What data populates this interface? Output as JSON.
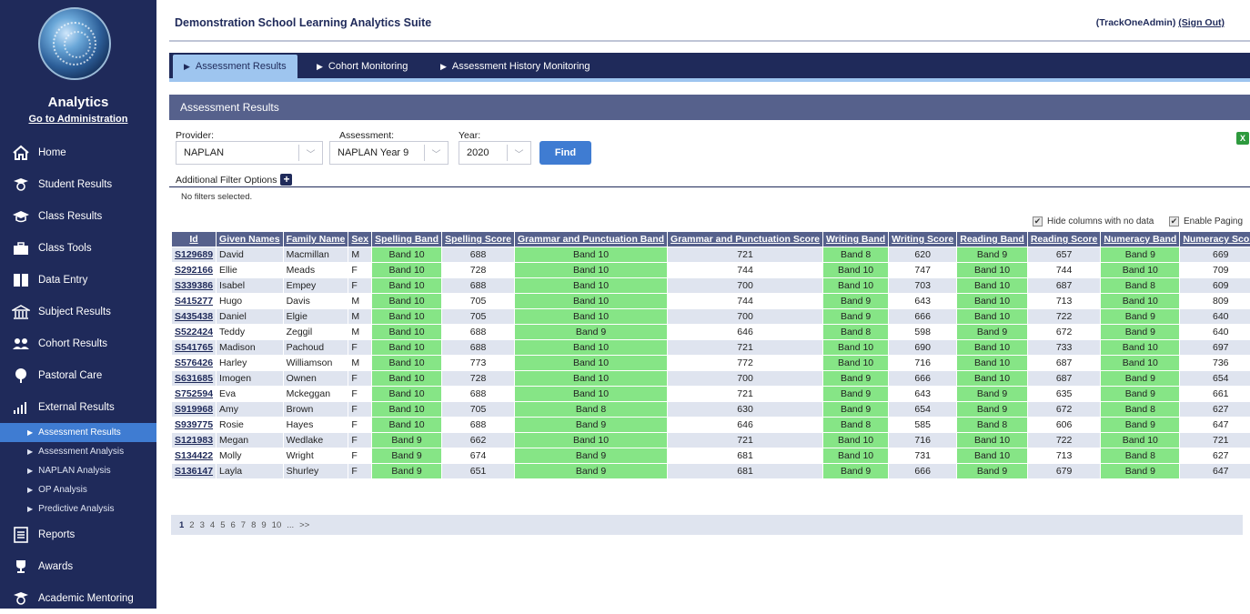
{
  "header": {
    "title": "Demonstration School Learning Analytics Suite",
    "user": "(TrackOneAdmin)",
    "signout": "(Sign Out)"
  },
  "sidebar": {
    "title": "Analytics",
    "admin_link": "Go to Administration",
    "items": [
      {
        "label": "Home",
        "icon": "home-icon"
      },
      {
        "label": "Student Results",
        "icon": "student-icon"
      },
      {
        "label": "Class Results",
        "icon": "class-icon"
      },
      {
        "label": "Class Tools",
        "icon": "toolbox-icon"
      },
      {
        "label": "Data Entry",
        "icon": "book-icon"
      },
      {
        "label": "Subject Results",
        "icon": "building-icon"
      },
      {
        "label": "Cohort Results",
        "icon": "group-icon"
      },
      {
        "label": "Pastoral Care",
        "icon": "tree-icon"
      },
      {
        "label": "External Results",
        "icon": "chart-icon"
      }
    ],
    "subitems": [
      "Assessment Results",
      "Assessment Analysis",
      "NAPLAN Analysis",
      "OP Analysis",
      "Predictive Analysis"
    ],
    "bottom_items": [
      {
        "label": "Reports",
        "icon": "report-icon"
      },
      {
        "label": "Awards",
        "icon": "trophy-icon"
      },
      {
        "label": "Academic Mentoring",
        "icon": "mentor-icon"
      }
    ]
  },
  "tabs": [
    "Assessment Results",
    "Cohort Monitoring",
    "Assessment History Monitoring"
  ],
  "panel": {
    "title": "Assessment Results"
  },
  "filters": {
    "provider_label": "Provider:",
    "provider_value": "NAPLAN",
    "assessment_label": "Assessment:",
    "assessment_value": "NAPLAN Year 9",
    "year_label": "Year:",
    "year_value": "2020",
    "find": "Find",
    "additional": "Additional Filter Options",
    "none": "No filters selected."
  },
  "options": {
    "hide_columns": "Hide columns with no data",
    "enable_paging": "Enable Paging"
  },
  "table": {
    "headers": [
      "Id",
      "Given Names",
      "Family Name",
      "Sex",
      "Spelling Band",
      "Spelling Score",
      "Grammar and Punctuation Band",
      "Grammar and Punctuation Score",
      "Writing Band",
      "Writing Score",
      "Reading Band",
      "Reading Score",
      "Numeracy Band",
      "Numeracy Score"
    ],
    "rows": [
      [
        "S129689",
        "David",
        "Macmillan",
        "M",
        "Band 10",
        "688",
        "Band 10",
        "721",
        "Band 8",
        "620",
        "Band 9",
        "657",
        "Band 9",
        "669"
      ],
      [
        "S292166",
        "Ellie",
        "Meads",
        "F",
        "Band 10",
        "728",
        "Band 10",
        "744",
        "Band 10",
        "747",
        "Band 10",
        "744",
        "Band 10",
        "709"
      ],
      [
        "S339386",
        "Isabel",
        "Empey",
        "F",
        "Band 10",
        "688",
        "Band 10",
        "700",
        "Band 10",
        "703",
        "Band 10",
        "687",
        "Band 8",
        "609"
      ],
      [
        "S415277",
        "Hugo",
        "Davis",
        "M",
        "Band 10",
        "705",
        "Band 10",
        "744",
        "Band 9",
        "643",
        "Band 10",
        "713",
        "Band 10",
        "809"
      ],
      [
        "S435438",
        "Daniel",
        "Elgie",
        "M",
        "Band 10",
        "705",
        "Band 10",
        "700",
        "Band 9",
        "666",
        "Band 10",
        "722",
        "Band 9",
        "640"
      ],
      [
        "S522424",
        "Teddy",
        "Zeggil",
        "M",
        "Band 10",
        "688",
        "Band 9",
        "646",
        "Band 8",
        "598",
        "Band 9",
        "672",
        "Band 9",
        "640"
      ],
      [
        "S541765",
        "Madison",
        "Pachoud",
        "F",
        "Band 10",
        "688",
        "Band 10",
        "721",
        "Band 10",
        "690",
        "Band 10",
        "733",
        "Band 10",
        "697"
      ],
      [
        "S576426",
        "Harley",
        "Williamson",
        "M",
        "Band 10",
        "773",
        "Band 10",
        "772",
        "Band 10",
        "716",
        "Band 10",
        "687",
        "Band 10",
        "736"
      ],
      [
        "S631685",
        "Imogen",
        "Ownen",
        "F",
        "Band 10",
        "728",
        "Band 10",
        "700",
        "Band 9",
        "666",
        "Band 10",
        "687",
        "Band 9",
        "654"
      ],
      [
        "S752594",
        "Eva",
        "Mckeggan",
        "F",
        "Band 10",
        "688",
        "Band 10",
        "721",
        "Band 9",
        "643",
        "Band 9",
        "635",
        "Band 9",
        "661"
      ],
      [
        "S919968",
        "Amy",
        "Brown",
        "F",
        "Band 10",
        "705",
        "Band 8",
        "630",
        "Band 9",
        "654",
        "Band 9",
        "672",
        "Band 8",
        "627"
      ],
      [
        "S939775",
        "Rosie",
        "Hayes",
        "F",
        "Band 10",
        "688",
        "Band 9",
        "646",
        "Band 8",
        "585",
        "Band 8",
        "606",
        "Band 9",
        "647"
      ],
      [
        "S121983",
        "Megan",
        "Wedlake",
        "F",
        "Band 9",
        "662",
        "Band 10",
        "721",
        "Band 10",
        "716",
        "Band 10",
        "722",
        "Band 10",
        "721"
      ],
      [
        "S134422",
        "Molly",
        "Wright",
        "F",
        "Band 9",
        "674",
        "Band 9",
        "681",
        "Band 10",
        "731",
        "Band 10",
        "713",
        "Band 8",
        "627"
      ],
      [
        "S136147",
        "Layla",
        "Shurley",
        "F",
        "Band 9",
        "651",
        "Band 9",
        "681",
        "Band 9",
        "666",
        "Band 9",
        "679",
        "Band 9",
        "647"
      ]
    ]
  },
  "pager": {
    "pages": [
      "1",
      "2",
      "3",
      "4",
      "5",
      "6",
      "7",
      "8",
      "9",
      "10",
      "...",
      ">>"
    ]
  },
  "colors": {
    "navy": "#1f2a5a",
    "band_green": "#86e586",
    "accent": "#3f7cd2"
  }
}
